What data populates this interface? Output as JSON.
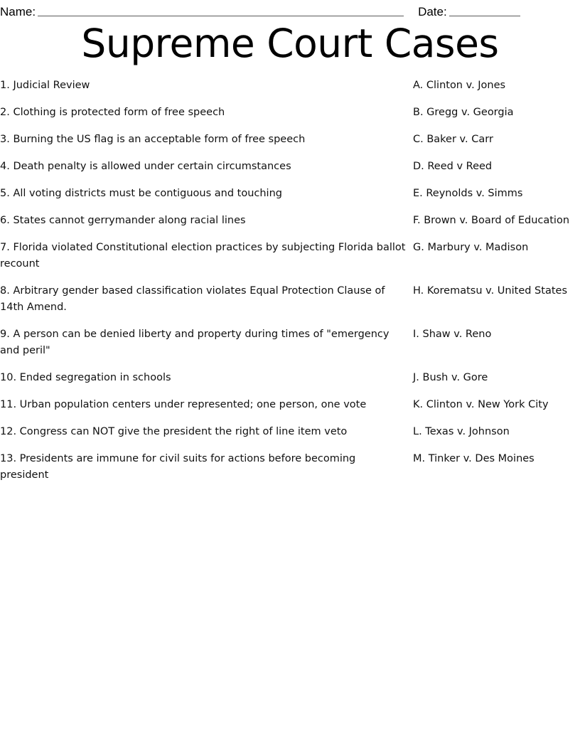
{
  "header": {
    "name_label": "Name:",
    "date_label": "Date:",
    "name_blank": "",
    "date_blank": ""
  },
  "title": "Supreme Court Cases",
  "worksheet": {
    "rows": [
      {
        "prompt": "1. Judicial Review",
        "choice": "A. Clinton v. Jones"
      },
      {
        "prompt": "2. Clothing is protected form of free speech",
        "choice": "B. Gregg v. Georgia"
      },
      {
        "prompt": "3. Burning the US flag is an acceptable form of free speech",
        "choice": "C. Baker v. Carr"
      },
      {
        "prompt": "4. Death penalty is allowed under certain circumstances",
        "choice": "D. Reed v Reed"
      },
      {
        "prompt": "5. All voting districts must be contiguous and touching",
        "choice": "E. Reynolds v. Simms"
      },
      {
        "prompt": "6. States cannot gerrymander along racial lines",
        "choice": "F. Brown v. Board of Education"
      },
      {
        "prompt": "7. Florida violated Constitutional election practices by subjecting Florida ballot recount",
        "choice": "G. Marbury v. Madison"
      },
      {
        "prompt": "8. Arbitrary gender based classification violates Equal Protection Clause of 14th Amend.",
        "choice": "H. Korematsu v. United States"
      },
      {
        "prompt": "9. A person can be denied liberty and property during times of \"emergency and peril\"",
        "choice": "I. Shaw v. Reno"
      },
      {
        "prompt": "10. Ended segregation in schools",
        "choice": "J. Bush v. Gore"
      },
      {
        "prompt": "11. Urban population centers under represented; one person, one vote",
        "choice": "K. Clinton v. New York City"
      },
      {
        "prompt": "12. Congress can NOT give the president the right of line item veto",
        "choice": "L. Texas v. Johnson"
      },
      {
        "prompt": "13. Presidents are immune for civil suits for actions before becoming president",
        "choice": "M. Tinker v. Des Moines"
      }
    ]
  }
}
